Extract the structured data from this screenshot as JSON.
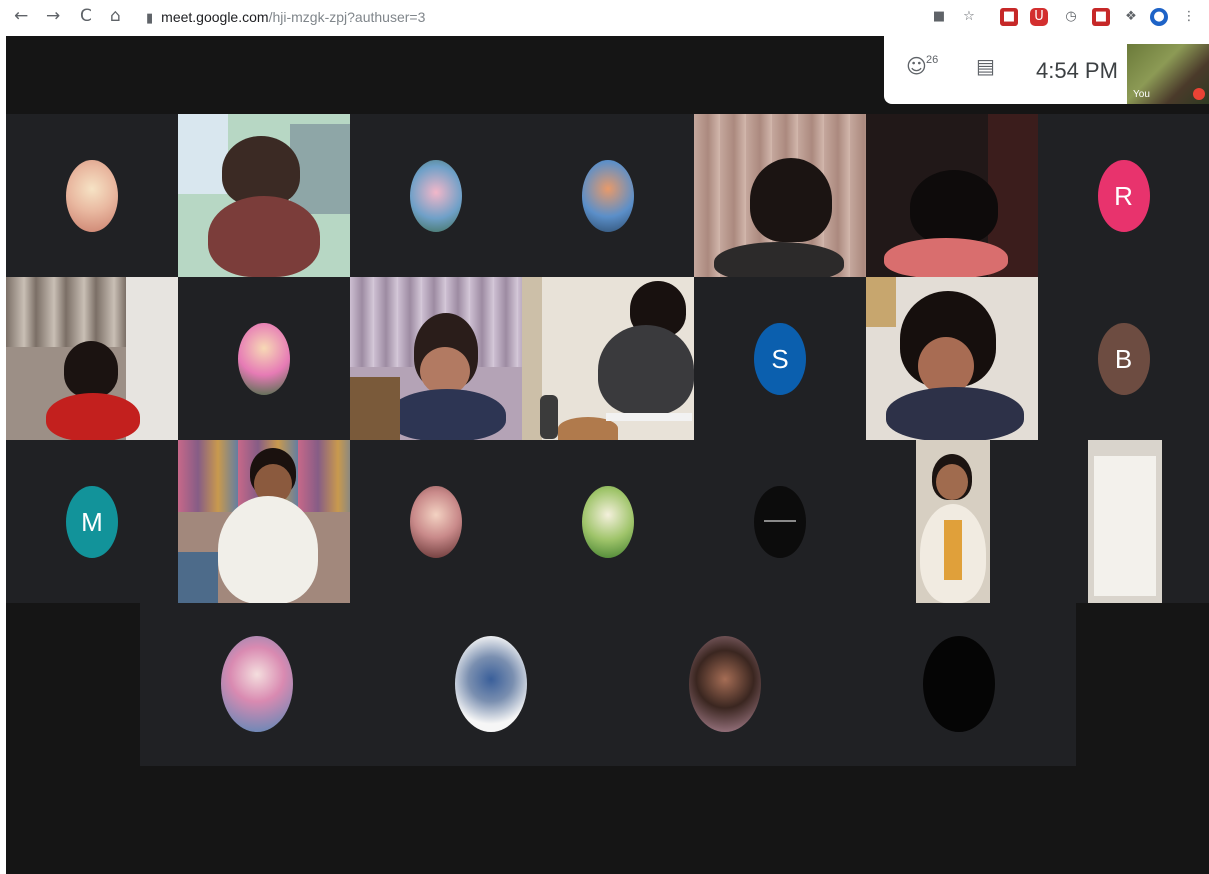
{
  "browser": {
    "back_icon": "←",
    "forward_icon": "→",
    "reload_icon": "C",
    "home_icon": "⌂",
    "lock_icon": "🔒",
    "url_host": "meet.google.com",
    "url_path": "/hji-mzgk-zpj?authuser=3",
    "menu_icon": "⋮"
  },
  "meet": {
    "participant_count": "26",
    "time": "4:54 PM",
    "self_label": "You"
  },
  "tiles": {
    "r": "R",
    "s": "S",
    "b": "B",
    "m": "M"
  },
  "colors": {
    "meet_bg": "#202124",
    "strip_bg": "#151515",
    "avatar_r": "#e8336d",
    "avatar_s": "#0b5fae",
    "avatar_b": "#6d4c41",
    "avatar_m": "#12939a"
  }
}
